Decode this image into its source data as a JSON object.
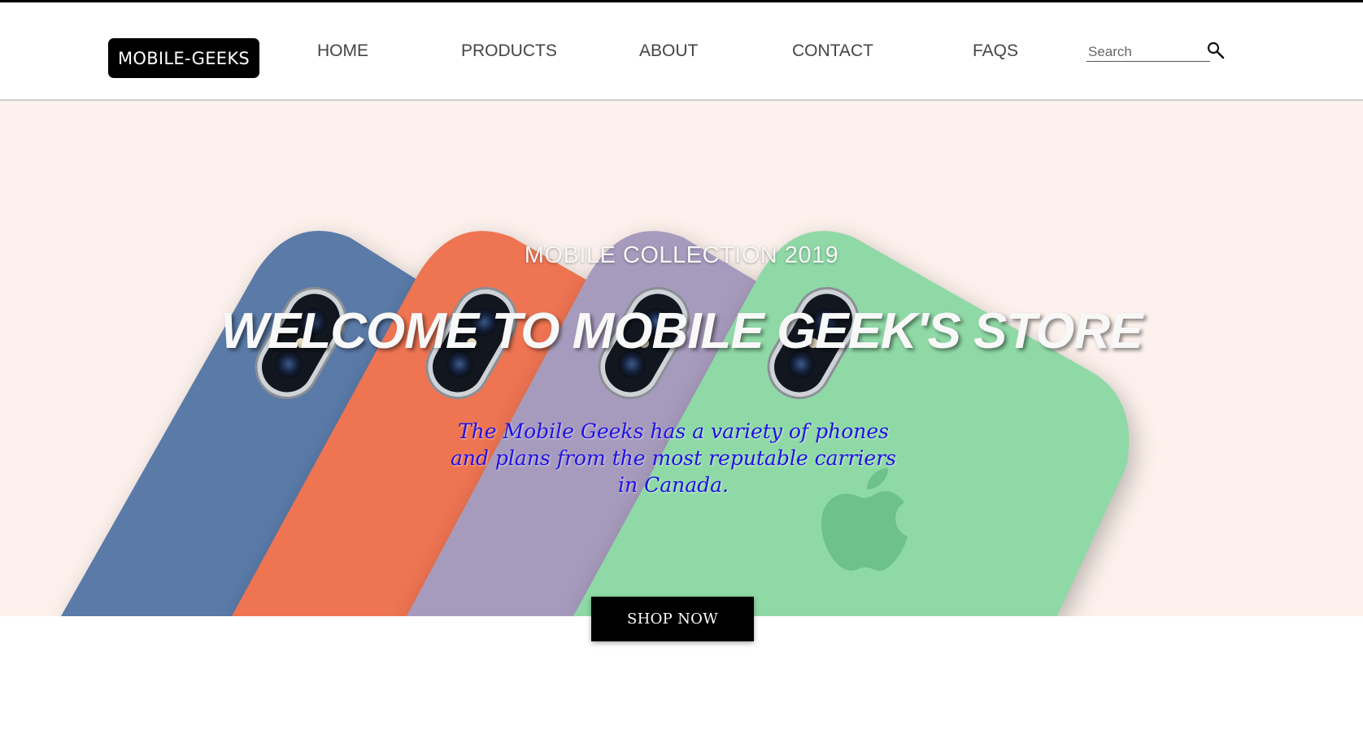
{
  "header": {
    "logo_text": "MOBILE-GEEKS",
    "nav": [
      {
        "label": "HOME"
      },
      {
        "label": "PRODUCTS"
      },
      {
        "label": "ABOUT"
      },
      {
        "label": "CONTACT"
      },
      {
        "label": "FAQS"
      }
    ],
    "search": {
      "placeholder": "Search",
      "value": "",
      "icon": "search-icon"
    }
  },
  "hero": {
    "subtitle": "MOBILE COLLECTION 2019",
    "title": "WELCOME TO MOBILE GEEK'S STORE",
    "description": "The Mobile Geeks has a variety of phones and plans from the most reputable carriers in Canada.",
    "cta_label": "SHOP NOW",
    "background_color": "#fcf1ec",
    "phone_colors": [
      "#5a7aa8",
      "#ee7452",
      "#a79bbd",
      "#8fd9a6"
    ]
  }
}
